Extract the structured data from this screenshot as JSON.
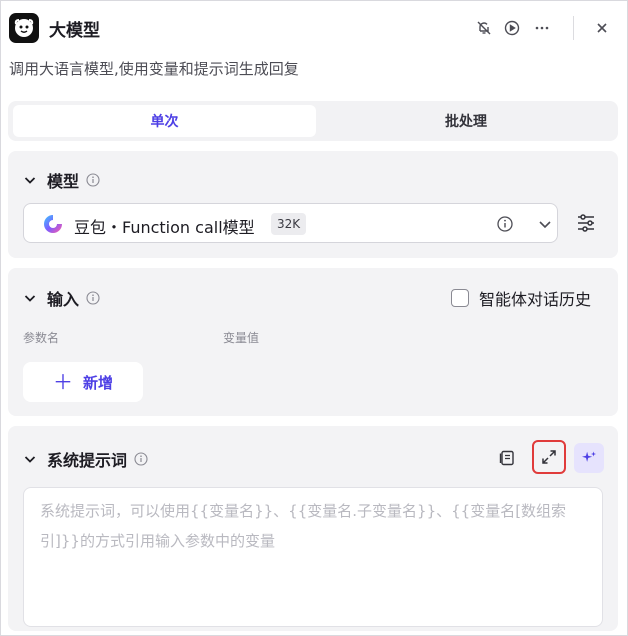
{
  "header": {
    "title": "大模型",
    "subtitle": "调用大语言模型,使用变量和提示词生成回复",
    "icons": [
      "robot-icon",
      "bell-off-icon",
      "play-icon",
      "more-icon",
      "close-icon"
    ]
  },
  "tabs": [
    {
      "label": "单次",
      "active": true
    },
    {
      "label": "批处理",
      "active": false
    }
  ],
  "model_section": {
    "title": "模型",
    "selected_model": "豆包・Function call模型",
    "context_badge": "32K"
  },
  "input_section": {
    "title": "输入",
    "history_checkbox_label": "智能体对话历史",
    "history_checked": false,
    "columns": [
      "参数名",
      "变量值"
    ],
    "add_button_label": "新增"
  },
  "system_prompt_section": {
    "title": "系统提示词",
    "placeholder": "系统提示词，可以使用{{变量名}}、{{变量名.子变量名}}、{{变量名[数组索引]}}的方式引用输入参数中的变量",
    "value": ""
  },
  "colors": {
    "accent": "#4e40e5",
    "highlight_border": "#e03b3b",
    "panel_bg": "#f3f3f5"
  }
}
